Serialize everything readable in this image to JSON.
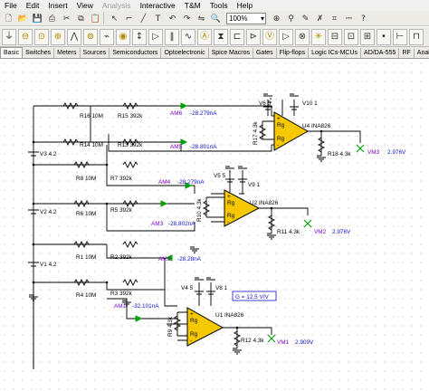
{
  "menu": [
    {
      "label": "File",
      "enabled": true
    },
    {
      "label": "Edit",
      "enabled": true
    },
    {
      "label": "Insert",
      "enabled": true
    },
    {
      "label": "View",
      "enabled": true
    },
    {
      "label": "Analysis",
      "enabled": false
    },
    {
      "label": "Interactive",
      "enabled": true
    },
    {
      "label": "T&M",
      "enabled": true
    },
    {
      "label": "Tools",
      "enabled": true
    },
    {
      "label": "Help",
      "enabled": true
    }
  ],
  "toolbar": {
    "zoom": "100%"
  },
  "part_tabs": [
    "Basic",
    "Switches",
    "Meters",
    "Sources",
    "Semiconductors",
    "Optoelectronic",
    "Spice Macros",
    "Gates",
    "Flip-flops",
    "Logic ICs-MCUs",
    "AD/DA-555",
    "RF",
    "Analog Cont"
  ],
  "active_tab": "Basic",
  "colors": {
    "wire": "#000000",
    "opamp": "#f5c800",
    "ammeter": "#00a000",
    "label_purple": "#7a00c0",
    "annotation_blue": "#1010cc"
  },
  "schematic": {
    "sources": [
      {
        "name": "V3 4.2"
      },
      {
        "name": "V2 4.2"
      },
      {
        "name": "V1 4.2"
      }
    ],
    "resistors": {
      "r16": "R16 10M",
      "r15": "R15 392k",
      "r14": "R14 10M",
      "r13": "R13 392k",
      "r8": "R8 10M",
      "r7": "R7 392k",
      "r6": "R6 10M",
      "r5": "R5 392k",
      "r1": "R1 10M",
      "r2": "R2 392k",
      "r4": "R4 10M",
      "r3": "R3 392k",
      "r17": "R17 4.3k",
      "r18": "R18 4.3k",
      "r10": "R10 4.3k",
      "r11": "R11 4.3k",
      "r9": "R9 4.3k",
      "r12": "R12 4.3k"
    },
    "supplies": {
      "v6": "V6 5",
      "v10": "V10 1",
      "v5": "V5 5",
      "v9": "V9 1",
      "v4": "V4 5",
      "v8": "V8 1"
    },
    "opamps": [
      {
        "name": "U4 INA826"
      },
      {
        "name": "U2 INA826"
      },
      {
        "name": "U1 INA826"
      }
    ],
    "ammeters": [
      {
        "name": "AM6",
        "value": "-28.279nA"
      },
      {
        "name": "AM5",
        "value": "-28.801nA"
      },
      {
        "name": "AM4",
        "value": "-28.279nA"
      },
      {
        "name": "AM3",
        "value": "-28.802nA"
      },
      {
        "name": "AM2",
        "value": "-28.28nA"
      },
      {
        "name": "AM1",
        "value": "-32.101nA"
      }
    ],
    "voltmeters": [
      {
        "name": "VM3",
        "value": "2.976V"
      },
      {
        "name": "VM2",
        "value": "2.976V"
      },
      {
        "name": "VM1",
        "value": "2.909V"
      }
    ],
    "pin_labels": {
      "plus": "+",
      "minus": "-",
      "rg": "Rg"
    },
    "gain_note": "G = 12.5 V/V"
  }
}
